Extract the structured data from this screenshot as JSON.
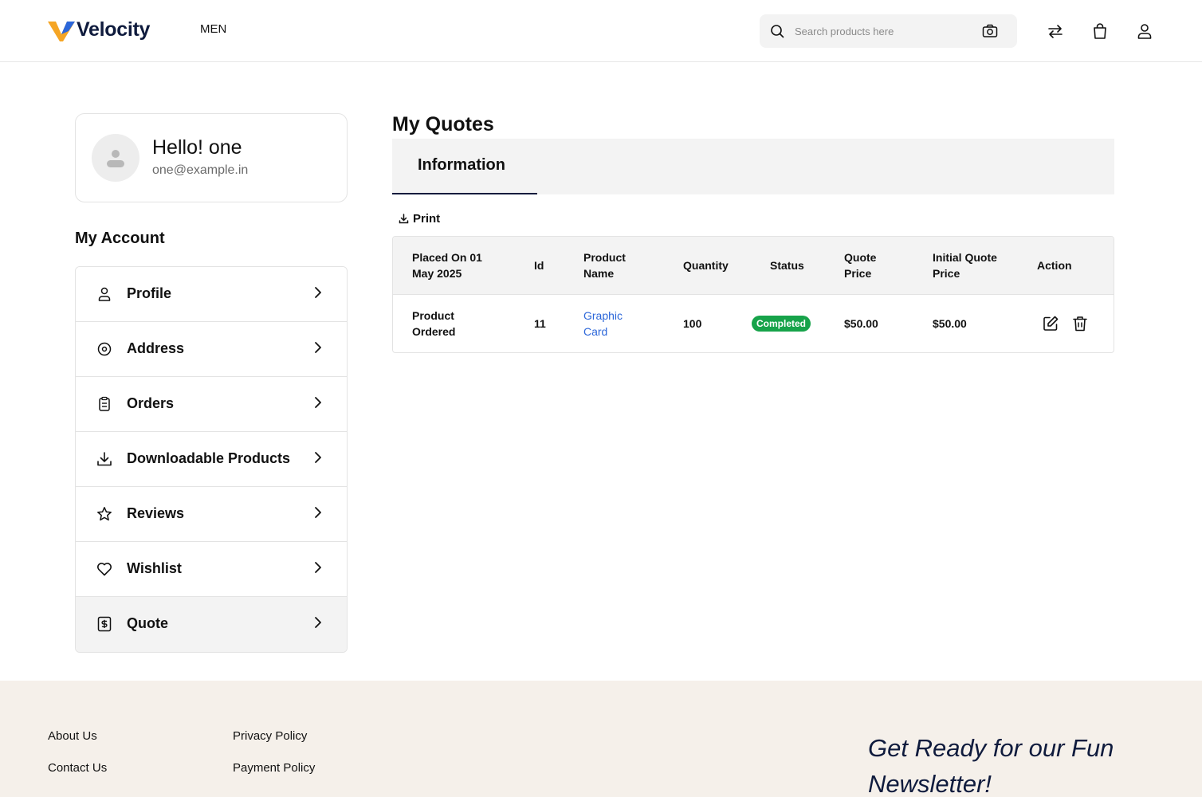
{
  "brand": {
    "name": "Velocity",
    "accent": "#0f1b3d",
    "logo_yellow": "#f5a524"
  },
  "nav": {
    "men": "MEN"
  },
  "search": {
    "placeholder": "Search products here"
  },
  "header_icons": [
    "compare-icon",
    "bag-icon",
    "user-icon"
  ],
  "profile": {
    "greeting": "Hello! one",
    "email": "one@example.in"
  },
  "sidebar": {
    "title": "My Account",
    "items": [
      {
        "label": "Profile",
        "icon": "user-icon"
      },
      {
        "label": "Address",
        "icon": "location-icon"
      },
      {
        "label": "Orders",
        "icon": "clipboard-icon"
      },
      {
        "label": "Downloadable Products",
        "icon": "download-icon"
      },
      {
        "label": "Reviews",
        "icon": "star-icon"
      },
      {
        "label": "Wishlist",
        "icon": "heart-icon"
      },
      {
        "label": "Quote",
        "icon": "quote-icon",
        "active": true
      }
    ]
  },
  "main": {
    "title": "My Quotes",
    "tab": "Information",
    "print": "Print",
    "table": {
      "headers": {
        "placed": "Placed On 01 May 2025",
        "id": "Id",
        "product": "Product Name",
        "quantity": "Quantity",
        "status": "Status",
        "quote_price": "Quote Price",
        "initial_price": "Initial Quote Price",
        "action": "Action"
      },
      "rows": [
        {
          "placed": "Product Ordered",
          "id": "11",
          "product": "Graphic Card",
          "quantity": "100",
          "status": "Completed",
          "quote_price": "$50.00",
          "initial_price": "$50.00"
        }
      ]
    },
    "status_color": "#17a34a",
    "link_color": "#2b66d9"
  },
  "footer": {
    "col1": [
      "About Us",
      "Contact Us"
    ],
    "col2": [
      "Privacy Policy",
      "Payment Policy"
    ],
    "newsletter": "Get Ready for our Fun Newsletter!"
  }
}
